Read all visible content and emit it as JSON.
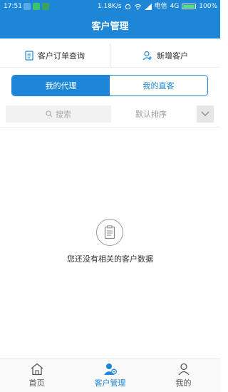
{
  "status_bar": {
    "time": "17:51",
    "network_speed": "1.18K/s",
    "carrier": "电信",
    "network_type": "4G",
    "battery": "100%"
  },
  "header": {
    "title": "客户管理"
  },
  "actions": {
    "order_query_label": "客户订单查询",
    "add_customer_label": "新增客户"
  },
  "segment": {
    "my_agent_label": "我的代理",
    "my_direct_label": "我的直客",
    "active": "my_agent"
  },
  "search": {
    "placeholder": "搜索",
    "sort_label": "默认排序"
  },
  "empty_state": {
    "message": "您还没有相关的客户数据"
  },
  "tabbar": {
    "items": [
      {
        "label": "首页",
        "icon": "home-icon",
        "active": false
      },
      {
        "label": "客户管理",
        "icon": "customer-manage-icon",
        "active": true
      },
      {
        "label": "我的",
        "icon": "user-icon",
        "active": false
      }
    ]
  },
  "colors": {
    "brand_blue": "#1d86d6",
    "battery_green": "#5fe05f"
  }
}
